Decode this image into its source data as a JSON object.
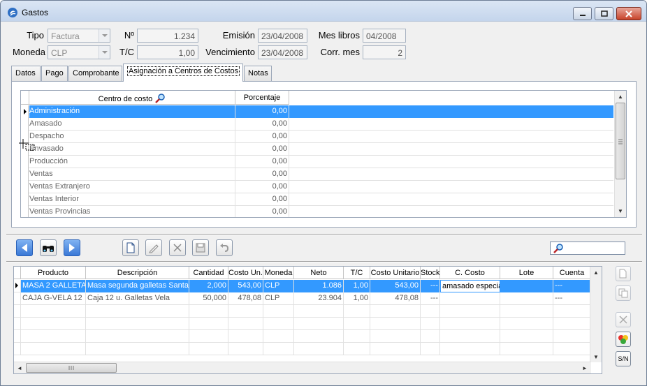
{
  "window": {
    "title": "Gastos"
  },
  "header": {
    "tipo_label": "Tipo",
    "tipo_value": "Factura",
    "numero_label": "Nº",
    "numero_value": "1.234",
    "emision_label": "Emisión",
    "emision_value": "23/04/2008",
    "mes_libros_label": "Mes libros",
    "mes_libros_value": "04/2008",
    "moneda_label": "Moneda",
    "moneda_value": "CLP",
    "tc_label": "T/C",
    "tc_value": "1,00",
    "vencimiento_label": "Vencimiento",
    "vencimiento_value": "23/04/2008",
    "corr_mes_label": "Corr. mes",
    "corr_mes_value": "2"
  },
  "tabs": [
    {
      "label": "Datos"
    },
    {
      "label": "Pago"
    },
    {
      "label": "Comprobante"
    },
    {
      "label": "Asignación a Centros de Costos"
    },
    {
      "label": "Notas"
    }
  ],
  "cost_center_grid": {
    "columns": [
      "Centro de costo",
      "Porcentaje"
    ],
    "rows": [
      {
        "name": "Administración",
        "pct": "0,00"
      },
      {
        "name": "Amasado",
        "pct": "0,00"
      },
      {
        "name": "Despacho",
        "pct": "0,00"
      },
      {
        "name": "Envasado",
        "pct": "0,00"
      },
      {
        "name": "Producción",
        "pct": "0,00"
      },
      {
        "name": "Ventas",
        "pct": "0,00"
      },
      {
        "name": "Ventas Extranjero",
        "pct": "0,00"
      },
      {
        "name": "Ventas Interior",
        "pct": "0,00"
      },
      {
        "name": "Ventas Provincias",
        "pct": "0,00"
      }
    ],
    "selected_row": 0
  },
  "items_grid": {
    "columns": [
      "Producto",
      "Descripción",
      "Cantidad",
      "Costo Un.",
      "Moneda",
      "Neto",
      "T/C",
      "Costo Unitario",
      "Stock",
      "C. Costo",
      "Lote",
      "Cuenta"
    ],
    "rows": [
      {
        "producto": "MASA 2 GALLETA",
        "descripcion": "Masa segunda galletas Santa",
        "cantidad": "2,000",
        "costo_un": "543,00",
        "moneda": "CLP",
        "neto": "1.086",
        "tc": "1,00",
        "costo_unitario": "543,00",
        "stock": "---",
        "c_costo": "amasado especia",
        "lote": "",
        "cuenta": "---"
      },
      {
        "producto": "CAJA G-VELA 12",
        "descripcion": "Caja 12 u. Galletas Vela",
        "cantidad": "50,000",
        "costo_un": "478,08",
        "moneda": "CLP",
        "neto": "23.904",
        "tc": "1,00",
        "costo_unitario": "478,08",
        "stock": "---",
        "c_costo": "",
        "lote": "",
        "cuenta": "---"
      }
    ],
    "selected_row": 0
  },
  "side_buttons": {
    "sn_label": "S/N"
  },
  "colors": {
    "selection": "#3399ff",
    "window_bg": "#f0f0f0"
  }
}
